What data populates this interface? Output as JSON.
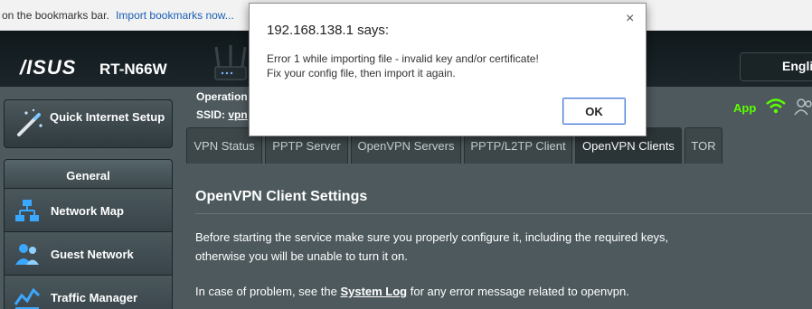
{
  "browser": {
    "bookmarks_text": "on the bookmarks bar.",
    "import_link": "Import bookmarks now..."
  },
  "banner": {
    "brand": "/ISUS",
    "model": "RT-N66W",
    "language": "Engli"
  },
  "status": {
    "operation_label": "Operation",
    "ssid_label": "SSID:",
    "ssid_value": "vpn",
    "app_label": "App"
  },
  "sidebar": {
    "quick_setup": "Quick Internet Setup",
    "section_header": "General",
    "items": [
      {
        "label": "Network Map",
        "icon": "network-map-icon"
      },
      {
        "label": "Guest Network",
        "icon": "guest-network-icon"
      },
      {
        "label": "Traffic Manager",
        "icon": "traffic-manager-icon"
      }
    ]
  },
  "tabs": [
    {
      "label": "VPN Status"
    },
    {
      "label": "PPTP Server"
    },
    {
      "label": "OpenVPN Servers"
    },
    {
      "label": "PPTP/L2TP Client"
    },
    {
      "label": "OpenVPN Clients"
    },
    {
      "label": "TOR"
    }
  ],
  "content": {
    "title": "OpenVPN Client Settings",
    "paragraph1": "Before starting the service make sure you properly configure it, including the required keys, otherwise you will be unable to turn it on.",
    "paragraph2_prefix": "In case of problem, see the ",
    "paragraph2_link": "System Log",
    "paragraph2_suffix": " for any error message related to openvpn."
  },
  "dialog": {
    "title": "192.168.138.1 says:",
    "close": "×",
    "message_line1": "Error 1 while importing file - invalid key and/or certificate!",
    "message_line2": "Fix your config file, then import it again.",
    "ok_label": "OK"
  },
  "colors": {
    "accent_green": "#5cff00",
    "panel_bg": "#4d595d",
    "link_blue": "#1a5fb4"
  }
}
